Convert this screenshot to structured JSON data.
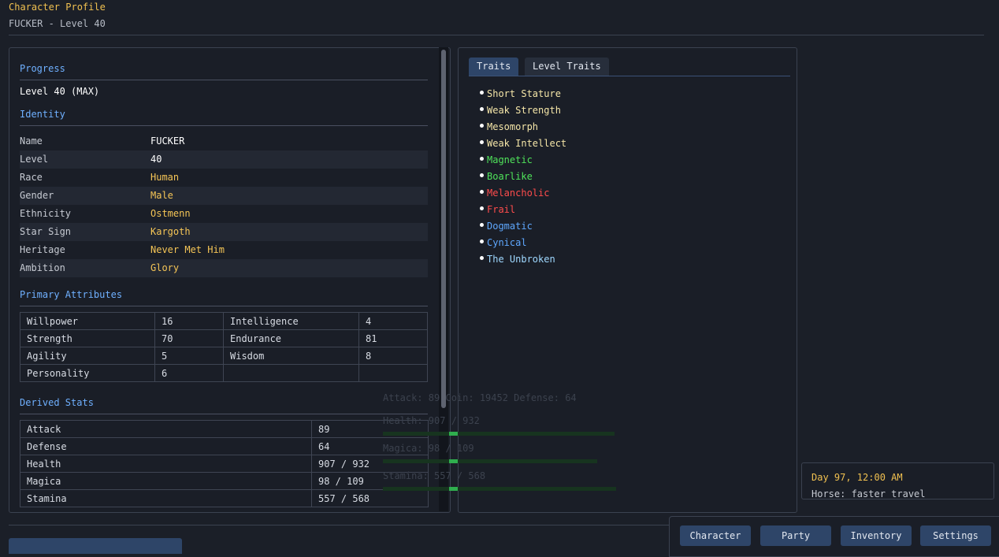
{
  "header": {
    "title": "Character Profile",
    "subtitle": "FUCKER - Level 40"
  },
  "progress": {
    "heading": "Progress",
    "text": "Level 40 (MAX)"
  },
  "identity": {
    "heading": "Identity",
    "rows": [
      {
        "label": "Name",
        "value": "FUCKER",
        "color": "#ffffff"
      },
      {
        "label": "Level",
        "value": "40",
        "color": "#ffffff"
      },
      {
        "label": "Race",
        "value": "Human",
        "color": "#f5c556"
      },
      {
        "label": "Gender",
        "value": "Male",
        "color": "#f5c556"
      },
      {
        "label": "Ethnicity",
        "value": "Ostmenn",
        "color": "#f5c556"
      },
      {
        "label": "Star Sign",
        "value": "Kargoth",
        "color": "#f5c556"
      },
      {
        "label": "Heritage",
        "value": "Never Met Him",
        "color": "#f5c556"
      },
      {
        "label": "Ambition",
        "value": "Glory",
        "color": "#f5c556"
      }
    ]
  },
  "primary": {
    "heading": "Primary Attributes",
    "rows": [
      [
        "Willpower",
        "16",
        "Intelligence",
        "4"
      ],
      [
        "Strength",
        "70",
        "Endurance",
        "81"
      ],
      [
        "Agility",
        "5",
        "Wisdom",
        "8"
      ],
      [
        "Personality",
        "6",
        "",
        ""
      ]
    ]
  },
  "derived": {
    "heading": "Derived Stats",
    "rows": [
      [
        "Attack",
        "89"
      ],
      [
        "Defense",
        "64"
      ],
      [
        "Health",
        "907 / 932"
      ],
      [
        "Magica",
        "98 / 109"
      ],
      [
        "Stamina",
        "557 / 568"
      ]
    ]
  },
  "tabs": [
    "Traits",
    "Level Traits"
  ],
  "traits": [
    {
      "name": "Short Stature",
      "color": "#f5e6a8"
    },
    {
      "name": "Weak Strength",
      "color": "#f5e6a8"
    },
    {
      "name": "Mesomorph",
      "color": "#f5e6a8"
    },
    {
      "name": "Weak Intellect",
      "color": "#f5e6a8"
    },
    {
      "name": "Magnetic",
      "color": "#4fe35a"
    },
    {
      "name": "Boarlike",
      "color": "#4fe35a"
    },
    {
      "name": "Melancholic",
      "color": "#ff4c4c"
    },
    {
      "name": "Frail",
      "color": "#ff4c4c"
    },
    {
      "name": "Dogmatic",
      "color": "#5fa8ff"
    },
    {
      "name": "Cynical",
      "color": "#5fa8ff"
    },
    {
      "name": "The Unbroken",
      "color": "#9fd8ff"
    }
  ],
  "overlay": {
    "summary": "Attack: 89  Coin: 19452  Defense: 64",
    "health": "Health: 907 / 932",
    "magica": "Magica: 98 / 109",
    "stamina": "Stamina: 557 / 568"
  },
  "info": {
    "date": "Day 97, 12:00 AM",
    "horse": "Horse: faster travel"
  },
  "nav": [
    "Character",
    "Party",
    "Inventory",
    "Settings"
  ]
}
